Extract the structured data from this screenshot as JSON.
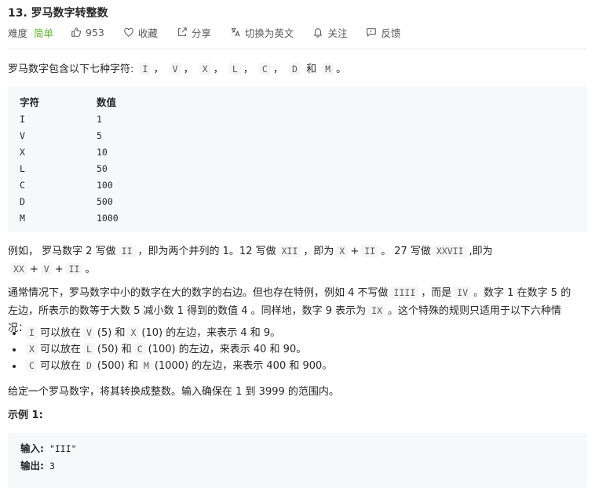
{
  "problem": {
    "title": "13. 罗马数字转整数",
    "difficulty_label": "难度",
    "difficulty": "简单",
    "likes": "953",
    "collect": "收藏",
    "share": "分享",
    "switch_lang": "切换为英文",
    "follow": "关注",
    "feedback": "反馈"
  },
  "intro": {
    "text": "罗马数字包含以下七种字符:",
    "chars": [
      "I",
      "V",
      "X",
      "L",
      "C",
      "D",
      "M"
    ],
    "sep": "，",
    "and": "和",
    "end": "。"
  },
  "table": {
    "headers": [
      "字符",
      "数值"
    ],
    "rows": [
      [
        "I",
        "1"
      ],
      [
        "V",
        "5"
      ],
      [
        "X",
        "10"
      ],
      [
        "L",
        "50"
      ],
      [
        "C",
        "100"
      ],
      [
        "D",
        "500"
      ],
      [
        "M",
        "1000"
      ]
    ]
  },
  "para2": {
    "t1": "例如， 罗马数字 2 写做",
    "c1": "II",
    "t2": "，即为两个并列的 1。12 写做",
    "c2": "XII",
    "t3": "，即为",
    "c3": "X",
    "t4": "+",
    "c4": "II",
    "t5": "。 27 写做",
    "c5": "XXVII",
    "t6": ",即为",
    "c6": "XX",
    "t7": "+",
    "c7": "V",
    "t8": "+",
    "c8": "II",
    "t9": "。"
  },
  "para3": {
    "t1": "通常情况下，罗马数字中小的数字在大的数字的右边。但也存在特例，例如 4 不写做",
    "c1": "IIII",
    "t2": "，而是",
    "c2": "IV",
    "t3": "。数字 1 在数字 5 的左边，所表示的数等于大数 5 减小数 1 得到的数值 4 。同样地，数字 9 表示为",
    "c3": "IX",
    "t4": "。这个特殊的规则只适用于以下六种情况："
  },
  "rules": [
    {
      "a": "I",
      "t1": "可以放在",
      "b": "V",
      "t2": "(5) 和",
      "c": "X",
      "t3": "(10) 的左边，来表示 4 和 9。"
    },
    {
      "a": "X",
      "t1": "可以放在",
      "b": "L",
      "t2": "(50) 和",
      "c": "C",
      "t3": "(100) 的左边，来表示 40 和 90。"
    },
    {
      "a": "C",
      "t1": "可以放在",
      "b": "D",
      "t2": "(500) 和",
      "c": "M",
      "t3": "(1000) 的左边，来表示 400 和 900。"
    }
  ],
  "para4": "给定一个罗马数字，将其转换成整数。输入确保在 1 到 3999 的范围内。",
  "example": {
    "title": "示例 1:",
    "input_label": "输入:",
    "input_value": "\"III\"",
    "output_label": "输出:",
    "output_value": "3"
  }
}
